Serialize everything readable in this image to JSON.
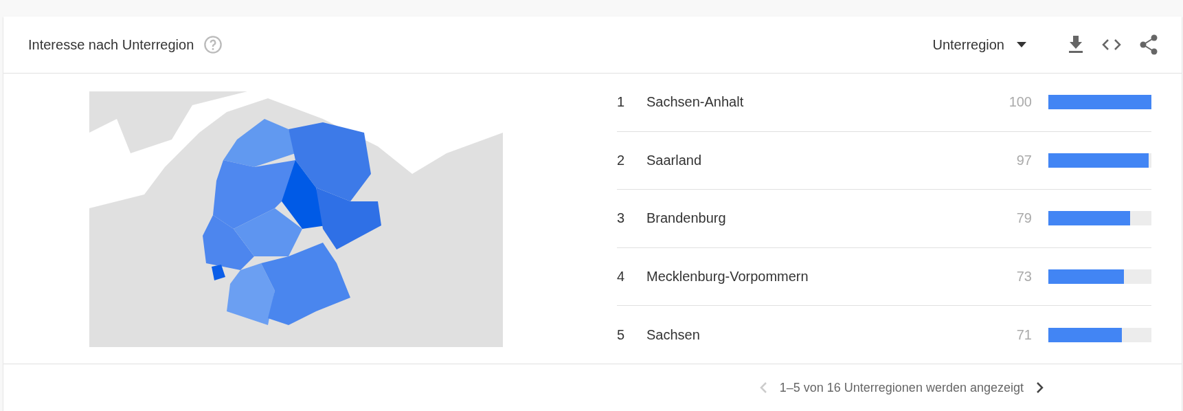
{
  "card": {
    "title": "Interesse nach Unterregion",
    "resolution": "Unterregion"
  },
  "rows": [
    {
      "rank": "1",
      "name": "Sachsen-Anhalt",
      "value": "100",
      "level": 1
    },
    {
      "rank": "2",
      "name": "Saarland",
      "value": "97",
      "level": 0.97
    },
    {
      "rank": "3",
      "name": "Brandenburg",
      "value": "79",
      "level": 0.79
    },
    {
      "rank": "4",
      "name": "Mecklenburg-Vorpommern",
      "value": "73",
      "level": 0.73
    },
    {
      "rank": "5",
      "name": "Sachsen",
      "value": "71",
      "level": 0.71
    }
  ],
  "pagination": {
    "text": "1–5 von 16 Unterregionen werden angezeigt",
    "prev_disabled": true,
    "next_disabled": false
  }
}
